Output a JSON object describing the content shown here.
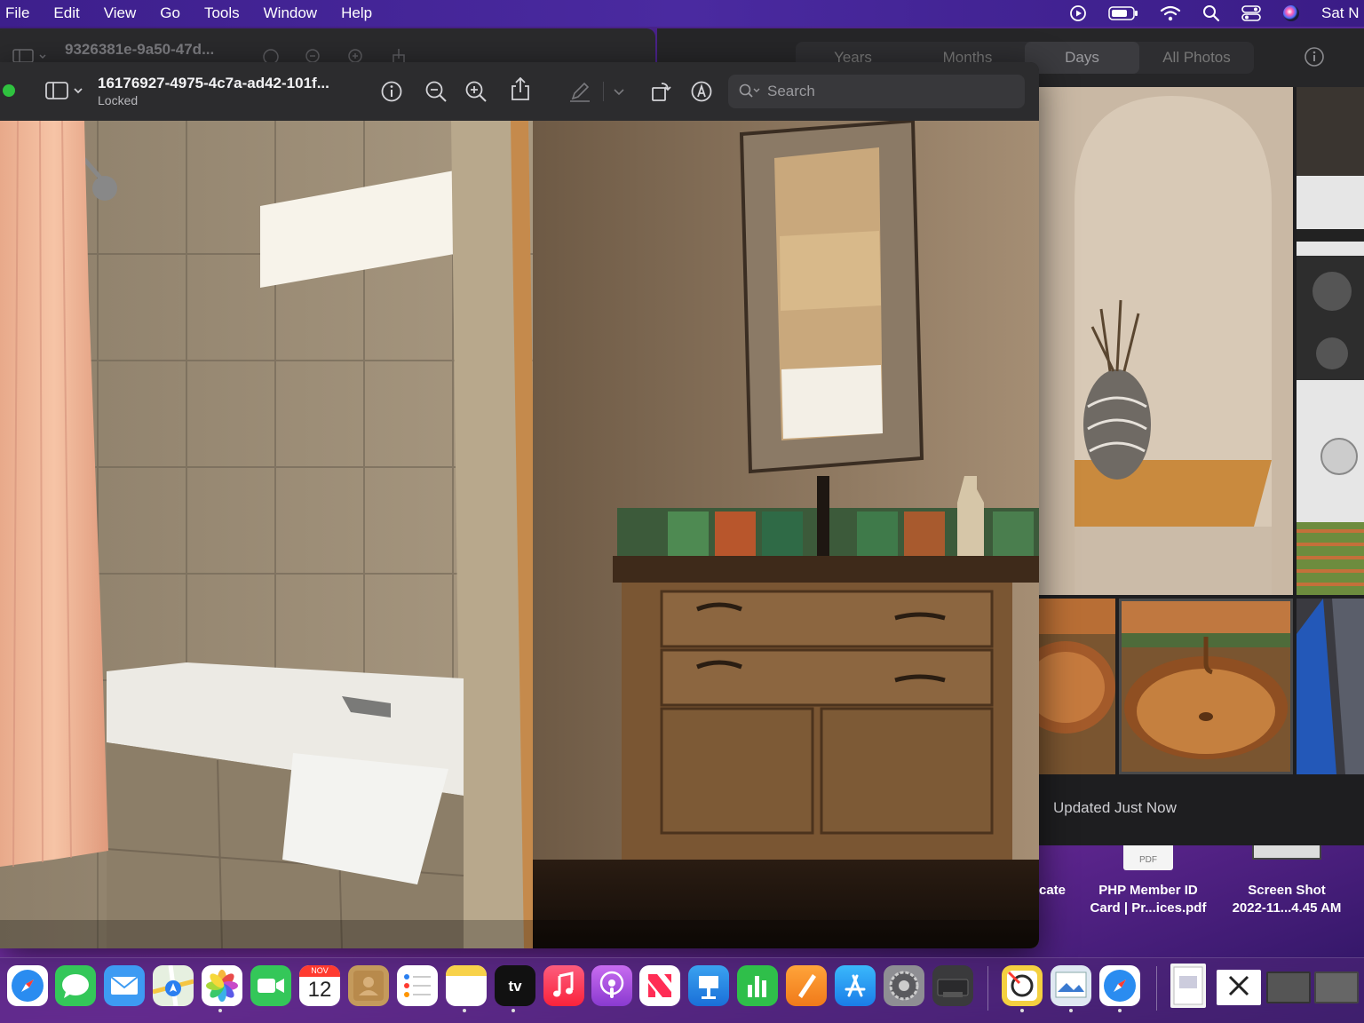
{
  "menubar": {
    "items": [
      "File",
      "Edit",
      "View",
      "Go",
      "Tools",
      "Window",
      "Help"
    ],
    "clock": "Sat N",
    "status_icons": [
      "play-circle-icon",
      "battery-icon",
      "wifi-icon",
      "search-icon",
      "control-center-icon",
      "siri-icon"
    ]
  },
  "back_preview": {
    "title": "9326381e-9a50-47d..."
  },
  "preview": {
    "title": "16176927-4975-4c7a-ad42-101f...",
    "subtitle": "Locked",
    "search_placeholder": "Search",
    "toolbar_icons": [
      "info-icon",
      "zoom-out-icon",
      "zoom-in-icon",
      "share-icon",
      "markup-pen-icon",
      "chevron-down-icon",
      "rotate-icon",
      "markup-circle-icon"
    ]
  },
  "photos": {
    "tabs": [
      {
        "label": "Years",
        "active": false
      },
      {
        "label": "Months",
        "active": false
      },
      {
        "label": "Days",
        "active": true
      },
      {
        "label": "All Photos",
        "active": false
      }
    ],
    "status": "Updated Just Now"
  },
  "desktop": {
    "files": [
      {
        "line1": "cate",
        "line2": ""
      },
      {
        "line1": "PHP Member ID",
        "line2": "Card | Pr...ices.pdf",
        "thumb": "PDF"
      },
      {
        "line1": "Screen Shot",
        "line2": "2022-11...4.45 AM"
      }
    ]
  },
  "dock": {
    "calendar_month": "NOV",
    "calendar_day": "12",
    "apps": [
      "Safari",
      "Messages",
      "Mail",
      "Maps",
      "Photos",
      "FaceTime",
      "Calendar",
      "Contacts",
      "Reminders",
      "Notes",
      "TV",
      "Music",
      "Podcasts",
      "News",
      "Keynote",
      "Numbers",
      "Pages",
      "App Store",
      "System Preferences",
      "Printer",
      "Capture One",
      "Preview",
      "Safari",
      "Downloads",
      "Desktop Folder",
      "Screenshots"
    ]
  }
}
